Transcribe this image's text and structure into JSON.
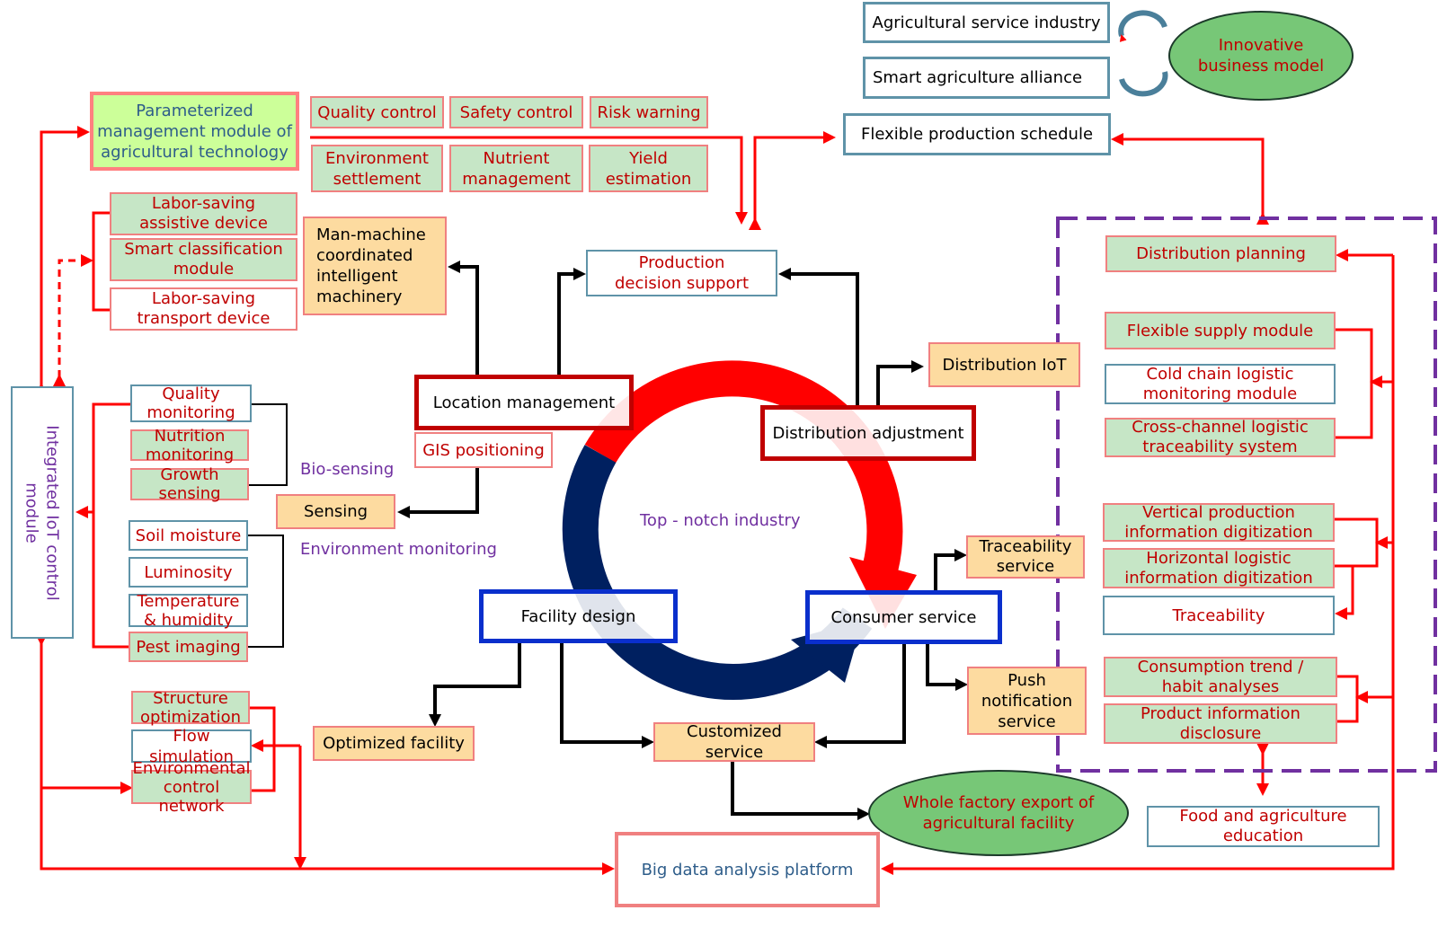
{
  "colors": {
    "red": "#ff0000",
    "dark_red": "#c00000",
    "navy": "#002060",
    "blue": "#0a2fcc",
    "purple": "#7030a0",
    "green_fill": "#c6e6c6",
    "orange_fill": "#fddba0",
    "lime_fill": "#ccff99"
  },
  "top": {
    "agri_service": "Agricultural service industry",
    "smart_alliance": "Smart agriculture alliance",
    "innovative": "Innovative\nbusiness model",
    "flexible_schedule": "Flexible production schedule"
  },
  "param": {
    "title": "Parameterized\nmanagement module of\nagricultural technology",
    "quality_control": "Quality control",
    "safety_control": "Safety control",
    "risk_warning": "Risk warning",
    "environment_settlement": "Environment\nsettlement",
    "nutrient_management": "Nutrient\nmanagement",
    "yield_estimation": "Yield\nestimation"
  },
  "machinery": {
    "assistive": "Labor-saving\nassistive device",
    "classification": "Smart classification\nmodule",
    "transport": "Labor-saving\ntransport device",
    "man_machine": "Man-machine\ncoordinated\nintelligent\nmachinery"
  },
  "center": {
    "production_decision": "Production\ndecision support",
    "location": "Location management",
    "gis": "GIS positioning",
    "distribution_adjustment": "Distribution adjustment",
    "distribution_iot": "Distribution IoT",
    "top_notch": "Top - notch industry",
    "facility_design": "Facility design",
    "consumer_service": "Consumer service",
    "traceability_service": "Traceability\nservice",
    "push_notification": "Push\nnotification\nservice",
    "optimized_facility": "Optimized facility",
    "customized_service": "Customized service",
    "whole_factory": "Whole factory export of\nagricultural facility",
    "big_data": "Big data analysis platform"
  },
  "iot": {
    "module": "Integrated IoT control\nmodule",
    "quality_monitoring": "Quality\nmonitoring",
    "nutrition_monitoring": "Nutrition\nmonitoring",
    "growth_sensing": "Growth\nsensing",
    "bio_sensing": "Bio-sensing",
    "sensing": "Sensing",
    "env_monitoring": "Environment monitoring",
    "soil_moisture": "Soil moisture",
    "luminosity": "Luminosity",
    "temp_humidity": "Temperature\n& humidity",
    "pest_imaging": "Pest imaging",
    "structure_opt": "Structure\noptimization",
    "flow_sim": "Flow simulation",
    "env_control": "Environmental\ncontrol network"
  },
  "right": {
    "distribution_planning": "Distribution planning",
    "flexible_supply": "Flexible supply module",
    "cold_chain": "Cold chain logistic\nmonitoring module",
    "cross_channel": "Cross-channel logistic\ntraceability system",
    "vertical": "Vertical production\ninformation digitization",
    "horizontal": "Horizontal logistic\ninformation digitization",
    "traceability": "Traceability",
    "consumption": "Consumption trend /\nhabit analyses",
    "product_info": "Product information\ndisclosure",
    "food_education": "Food and agriculture\neducation"
  }
}
